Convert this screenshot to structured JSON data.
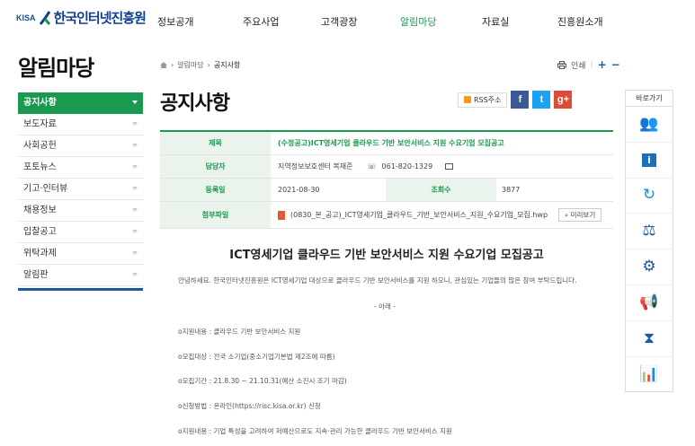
{
  "header": {
    "logo_prefix": "KISA",
    "logo_text": "한국인터넷진흥원",
    "nav": [
      {
        "label": "정보공개",
        "active": false
      },
      {
        "label": "주요사업",
        "active": false
      },
      {
        "label": "고객광장",
        "active": false
      },
      {
        "label": "알림마당",
        "active": true
      },
      {
        "label": "자료실",
        "active": false
      },
      {
        "label": "진흥원소개",
        "active": false
      }
    ]
  },
  "sidebar": {
    "title": "알림마당",
    "items": [
      {
        "label": "공지사항",
        "active": true
      },
      {
        "label": "보도자료",
        "active": false
      },
      {
        "label": "사회공헌",
        "active": false
      },
      {
        "label": "포토뉴스",
        "active": false
      },
      {
        "label": "기고·인터뷰",
        "active": false
      },
      {
        "label": "채용정보",
        "active": false
      },
      {
        "label": "입찰공고",
        "active": false
      },
      {
        "label": "위탁과제",
        "active": false
      },
      {
        "label": "알림판",
        "active": false
      }
    ]
  },
  "breadcrumb": {
    "parent": "알림마당",
    "current": "공지사항"
  },
  "util": {
    "print_label": "인쇄",
    "zoom_in": "+",
    "zoom_out": "−"
  },
  "page_title": "공지사항",
  "share": {
    "rss_label": "RSS주소"
  },
  "notice": {
    "labels": {
      "title": "제목",
      "author": "담당자",
      "date": "등록일",
      "views": "조회수",
      "attachment": "첨부파일"
    },
    "title": "(수정공고)ICT영세기업 클라우드 기반 보안서비스 지원 수요기업 모집공고",
    "author": "지역정보보호센터 복채준",
    "phone": "061-820-1329",
    "date": "2021-08-30",
    "views": "3877",
    "attachment": "(0830_본_공고)_ICT영세기업_클라우드_기반_보안서비스_지원_수요기업_모집.hwp",
    "preview_label": "미리보기"
  },
  "content": {
    "heading": "ICT영세기업 클라우드 기반 보안서비스 지원 수요기업 모집공고",
    "intro": "안녕하세요. 한국인터넷진흥원은 ICT영세기업 대상으로 클라우드 기반 보안서비스를 지원 하오니, 관심있는 기업들의 많은 참여 부탁드립니다.",
    "below": "- 아래 -",
    "lines": [
      "o지원내용 : 클라우드 기반 보안서비스 지원",
      "o모집대상 : 전국 소기업(중소기업기본법 제2조에 따름)",
      "o모집기간 : 21.8.30 ~ 21.10.31(예산 소진시 조기 마감)",
      "o신청방법 : 온라인(https://risc.kisa.or.kr) 신청",
      "o지원내용 : 기업 특성을 고려하여 저예산으로도 지속·관리 가능한 클라우드 기반 보안서비스 지원"
    ]
  },
  "quick_menu": {
    "title": "바로가기",
    "icons": [
      "people-icon",
      "info-icon",
      "refresh-icon",
      "scale-icon",
      "gears-icon",
      "megaphone-icon",
      "hourglass-icon",
      "growth-chart-icon"
    ]
  }
}
